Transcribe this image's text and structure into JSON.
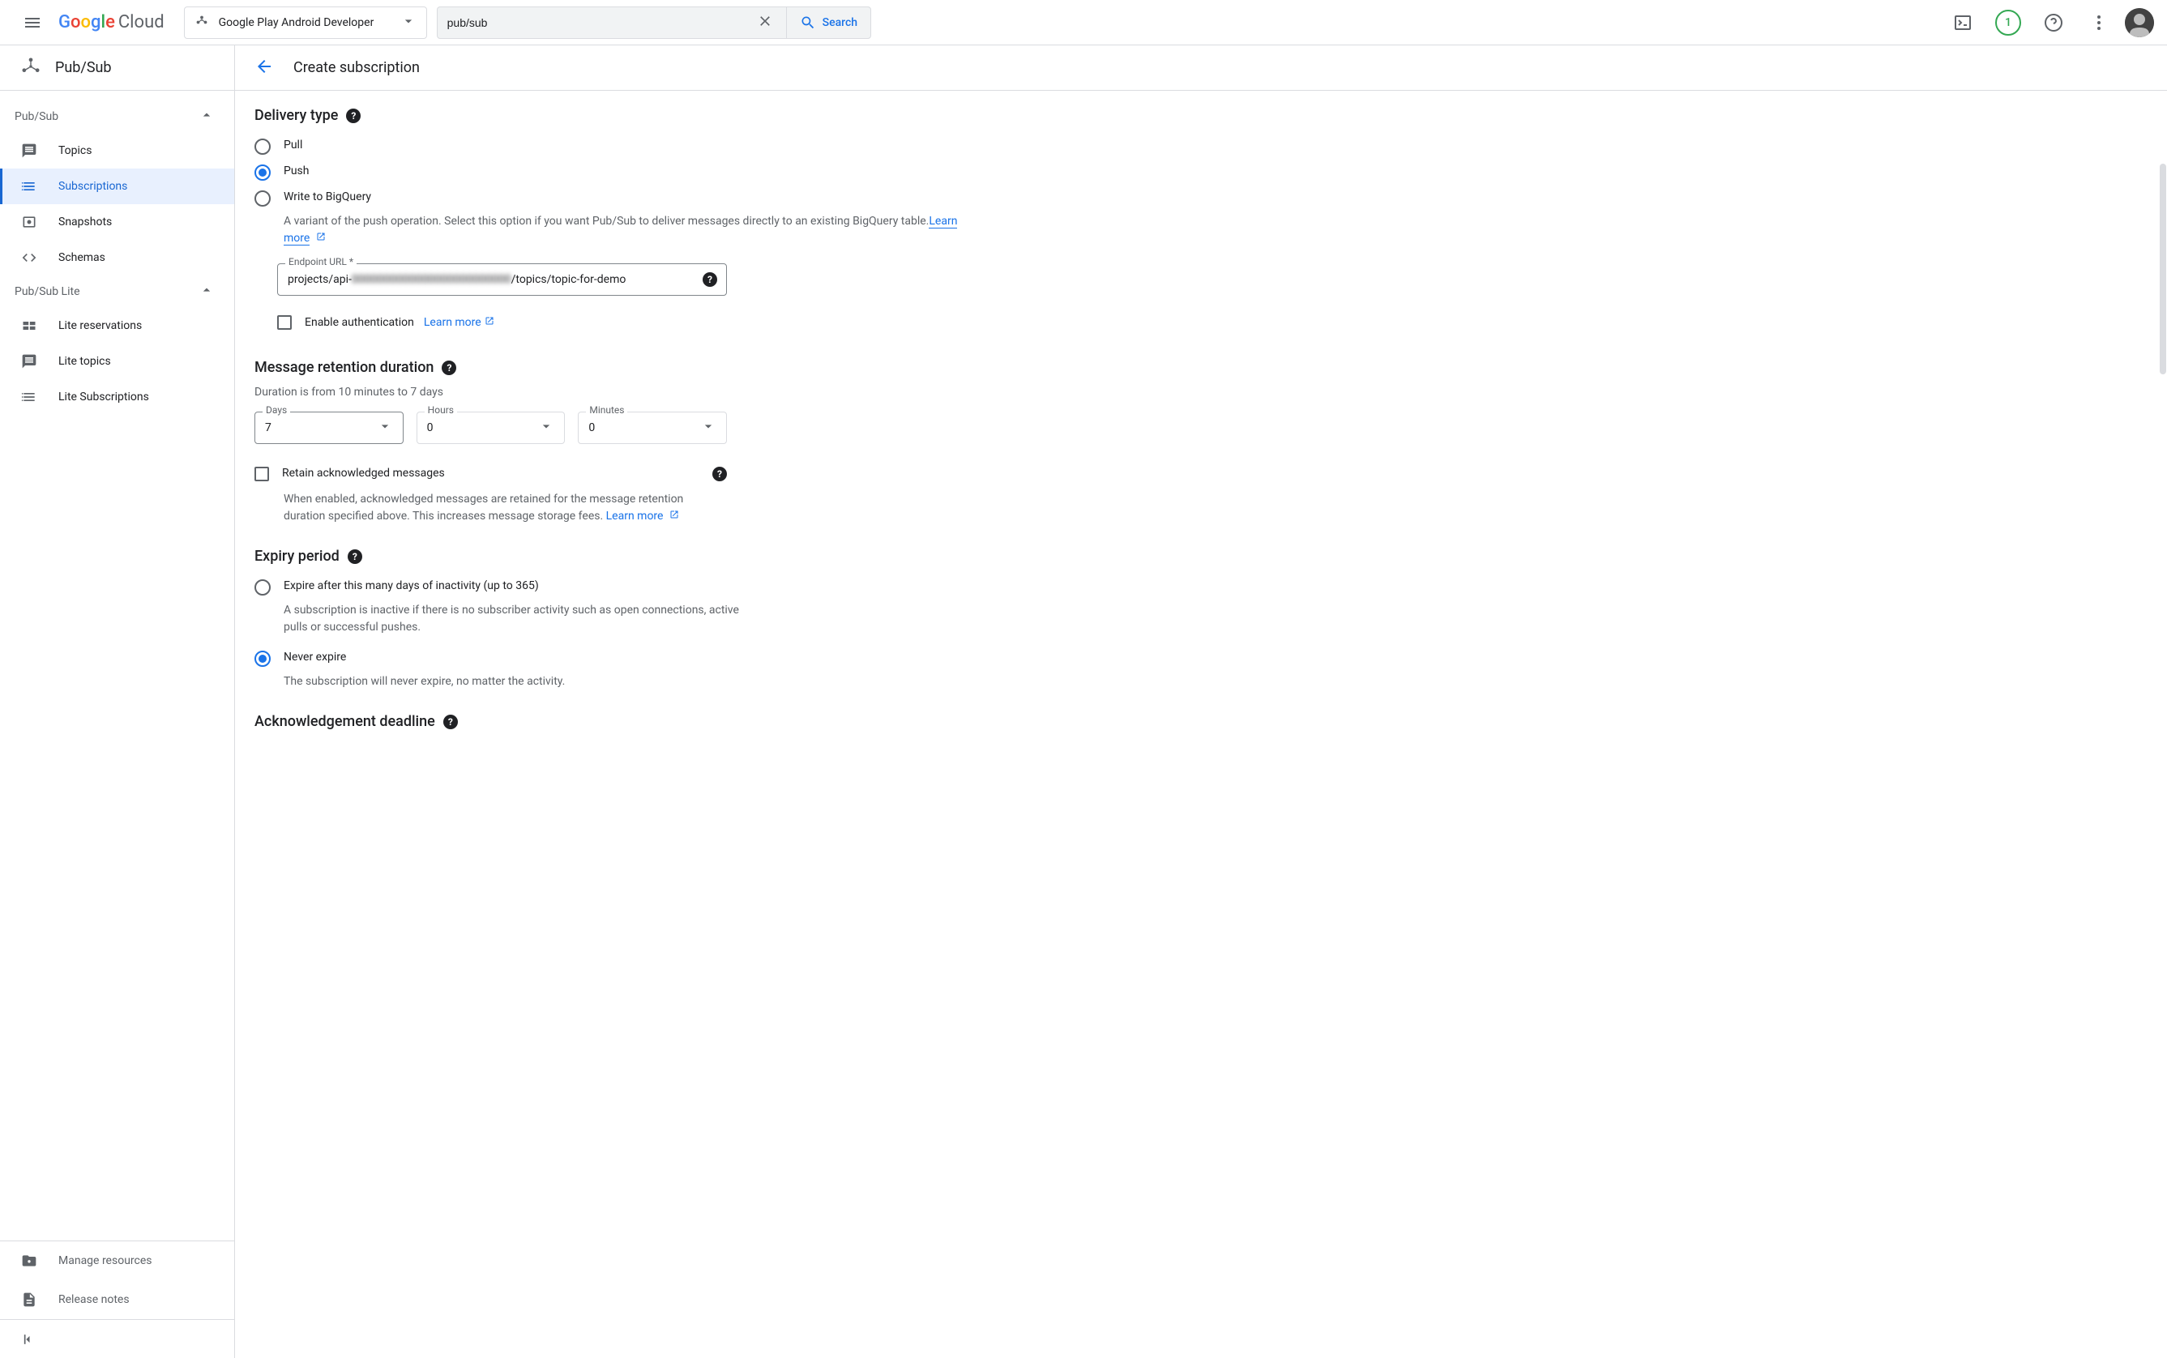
{
  "header": {
    "logo_text": "Google",
    "logo_suffix": "Cloud",
    "project_name": "Google Play Android Developer",
    "search_value": "pub/sub",
    "search_button": "Search",
    "notification_count": "1"
  },
  "sidebar": {
    "product_title": "Pub/Sub",
    "groups": [
      {
        "label": "Pub/Sub",
        "items": [
          {
            "label": "Topics",
            "icon": "topics"
          },
          {
            "label": "Subscriptions",
            "icon": "subscriptions",
            "active": true
          },
          {
            "label": "Snapshots",
            "icon": "snapshots"
          },
          {
            "label": "Schemas",
            "icon": "schemas"
          }
        ]
      },
      {
        "label": "Pub/Sub Lite",
        "items": [
          {
            "label": "Lite reservations",
            "icon": "lite-reservations"
          },
          {
            "label": "Lite topics",
            "icon": "lite-topics"
          },
          {
            "label": "Lite Subscriptions",
            "icon": "lite-subscriptions"
          }
        ]
      }
    ],
    "footer": [
      {
        "label": "Manage resources"
      },
      {
        "label": "Release notes"
      }
    ]
  },
  "content": {
    "page_title": "Create subscription",
    "delivery_type": {
      "heading": "Delivery type",
      "pull": "Pull",
      "push": "Push",
      "bigquery": "Write to BigQuery",
      "bigquery_desc": "A variant of the push operation. Select this option if you want Pub/Sub to deliver messages directly to an existing BigQuery table.",
      "learn_more": "Learn more",
      "endpoint_label": "Endpoint URL *",
      "endpoint_prefix": "projects/api-",
      "endpoint_blurred": "0000000000000000000000000",
      "endpoint_suffix": "/topics/topic-for-demo",
      "enable_auth": "Enable authentication",
      "auth_learn_more": "Learn more"
    },
    "retention": {
      "heading": "Message retention duration",
      "hint": "Duration is from 10 minutes to 7 days",
      "days_label": "Days",
      "days_value": "7",
      "hours_label": "Hours",
      "hours_value": "0",
      "minutes_label": "Minutes",
      "minutes_value": "0",
      "retain_label": "Retain acknowledged messages",
      "retain_desc": "When enabled, acknowledged messages are retained for the message retention duration specified above. This increases message storage fees. ",
      "retain_learn_more": "Learn more"
    },
    "expiry": {
      "heading": "Expiry period",
      "option1": "Expire after this many days of inactivity (up to 365)",
      "option1_desc": "A subscription is inactive if there is no subscriber activity such as open connections, active pulls or successful pushes.",
      "option2": "Never expire",
      "option2_desc": "The subscription will never expire, no matter the activity."
    },
    "ack": {
      "heading": "Acknowledgement deadline"
    }
  }
}
